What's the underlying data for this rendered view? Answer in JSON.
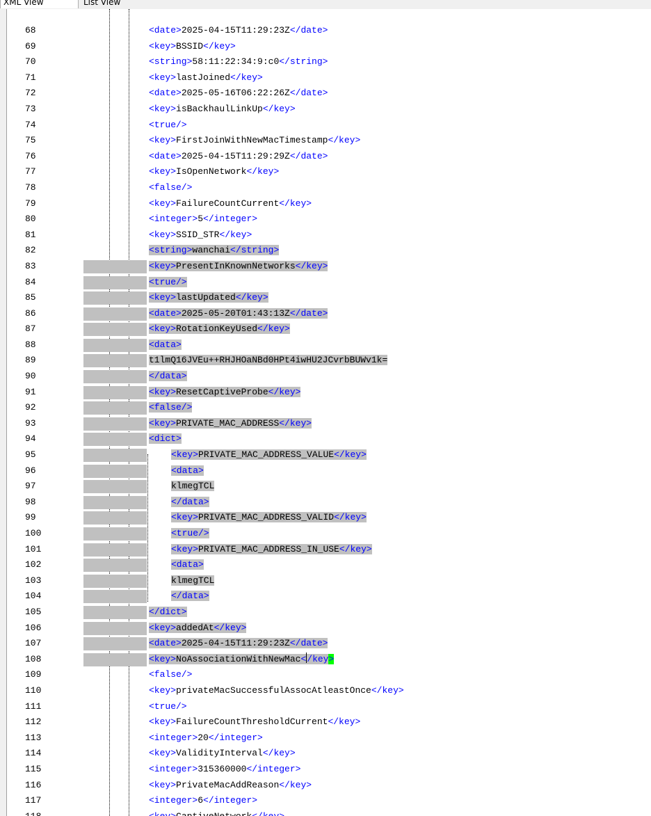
{
  "tabs": [
    {
      "label": "XML View",
      "active": true
    },
    {
      "label": "List View",
      "active": false
    }
  ],
  "colors": {
    "tag": "#0000ff",
    "text": "#000000",
    "selection": "#c0c0c0",
    "bracket_match": "#00ff00",
    "background": "#ffffff"
  },
  "editor": {
    "lines": [
      {
        "n": "68",
        "text": "<date>2025-04-15T11:29:23Z</date>"
      },
      {
        "n": "69",
        "text": "<key>BSSID</key>"
      },
      {
        "n": "70",
        "text": "<string>58:11:22:34:9:c0</string>"
      },
      {
        "n": "71",
        "text": "<key>lastJoined</key>"
      },
      {
        "n": "72",
        "text": "<date>2025-05-16T06:22:26Z</date>"
      },
      {
        "n": "73",
        "text": "<key>isBackhaulLinkUp</key>"
      },
      {
        "n": "74",
        "text": "<true/>"
      },
      {
        "n": "75",
        "text": "<key>FirstJoinWithNewMacTimestamp</key>"
      },
      {
        "n": "76",
        "text": "<date>2025-04-15T11:29:29Z</date>"
      },
      {
        "n": "77",
        "text": "<key>IsOpenNetwork</key>"
      },
      {
        "n": "78",
        "text": "<false/>"
      },
      {
        "n": "79",
        "text": "<key>FailureCountCurrent</key>"
      },
      {
        "n": "80",
        "text": "<integer>5</integer>"
      },
      {
        "n": "81",
        "text": "<key>SSID_STR</key>"
      },
      {
        "n": "82",
        "text": "<string>wanchai</string>"
      },
      {
        "n": "83",
        "text": "<key>PresentInKnownNetworks</key>"
      },
      {
        "n": "84",
        "text": "<true/>"
      },
      {
        "n": "85",
        "text": "<key>lastUpdated</key>"
      },
      {
        "n": "86",
        "text": "<date>2025-05-20T01:43:13Z</date>"
      },
      {
        "n": "87",
        "text": "<key>RotationKeyUsed</key>"
      },
      {
        "n": "88",
        "text": "<data>"
      },
      {
        "n": "89",
        "text": "t1lmQ16JVEu++RHJHOaNBd0HPt4iwHU2JCvrbBUWv1k="
      },
      {
        "n": "90",
        "text": "</data>"
      },
      {
        "n": "91",
        "text": "<key>ResetCaptiveProbe</key>"
      },
      {
        "n": "92",
        "text": "<false/>"
      },
      {
        "n": "93",
        "text": "<key>PRIVATE_MAC_ADDRESS</key>"
      },
      {
        "n": "94",
        "text": "<dict>"
      },
      {
        "n": "95",
        "text": "<key>PRIVATE_MAC_ADDRESS_VALUE</key>"
      },
      {
        "n": "96",
        "text": "<data>"
      },
      {
        "n": "97",
        "text": "klmegTCL"
      },
      {
        "n": "98",
        "text": "</data>"
      },
      {
        "n": "99",
        "text": "<key>PRIVATE_MAC_ADDRESS_VALID</key>"
      },
      {
        "n": "100",
        "text": "<true/>"
      },
      {
        "n": "101",
        "text": "<key>PRIVATE_MAC_ADDRESS_IN_USE</key>"
      },
      {
        "n": "102",
        "text": "<data>"
      },
      {
        "n": "103",
        "text": "klmegTCL"
      },
      {
        "n": "104",
        "text": "</data>"
      },
      {
        "n": "105",
        "text": "</dict>"
      },
      {
        "n": "106",
        "text": "<key>addedAt</key>"
      },
      {
        "n": "107",
        "text": "<date>2025-04-15T11:29:23Z</date>"
      },
      {
        "n": "108",
        "text": "<key>NoAssociationWithNewMac</key>"
      },
      {
        "n": "109",
        "text": "<false/>"
      },
      {
        "n": "110",
        "text": "<key>privateMacSuccessfulAssocAtleastOnce</key>"
      },
      {
        "n": "111",
        "text": "<true/>"
      },
      {
        "n": "112",
        "text": "<key>FailureCountThresholdCurrent</key>"
      },
      {
        "n": "113",
        "text": "<integer>20</integer>"
      },
      {
        "n": "114",
        "text": "<key>ValidityInterval</key>"
      },
      {
        "n": "115",
        "text": "<integer>315360000</integer>"
      },
      {
        "n": "116",
        "text": "<key>PrivateMacAddReason</key>"
      },
      {
        "n": "117",
        "text": "<integer>6</integer>"
      },
      {
        "n": "118",
        "text": "<key>CaptiveNetwork</key>"
      }
    ]
  }
}
